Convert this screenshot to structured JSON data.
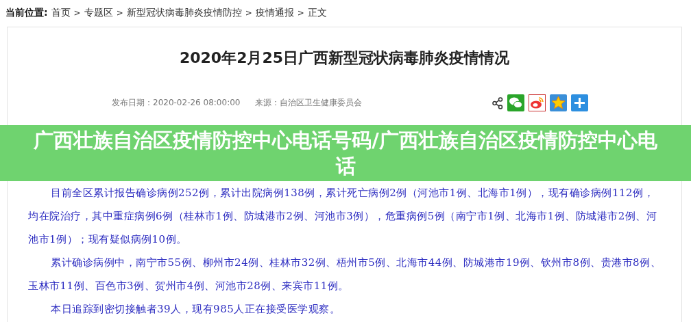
{
  "breadcrumb": {
    "label": "当前位置:",
    "items": [
      "首页",
      "专题区",
      "新型冠状病毒肺炎疫情防控",
      "疫情通报",
      "正文"
    ],
    "separator": ">"
  },
  "article": {
    "title": "2020年2月25日广西新型冠状病毒肺炎疫情情况",
    "date_label": "发布日期：",
    "date": "2020-02-26 08:00:00",
    "source_label": "来源：",
    "source": "自治区卫生健康委员会",
    "paragraphs": [
      "目前全区累计报告确诊病例252例，累计出院病例138例，累计死亡病例2例（河池市1例、北海市1例），现有确诊病例112例，均在院治疗，其中重症病例6例（桂林市1例、防城港市2例、河池市3例），危重病例5例（南宁市1例、北海市1例、防城港市2例、河池市1例）；现有疑似病例10例。",
      "累计确诊病例中，南宁市55例、柳州市24例、桂林市32例、梧州市5例、北海市44例、防城港市19例、钦州市8例、贵港市8例、玉林市11例、百色市3例、贺州市4例、河池市28例、来宾市11例。",
      "本日追踪到密切接触者39人，现有985人正在接受医学观察。"
    ]
  },
  "share": [
    {
      "kind": "share"
    },
    {
      "kind": "wechat"
    },
    {
      "kind": "weibo"
    },
    {
      "kind": "qzone"
    },
    {
      "kind": "more"
    }
  ],
  "banner": {
    "title": "广西壮族自治区疫情防控中心电话号码/广西壮族自治区疫情防控中心电话"
  }
}
